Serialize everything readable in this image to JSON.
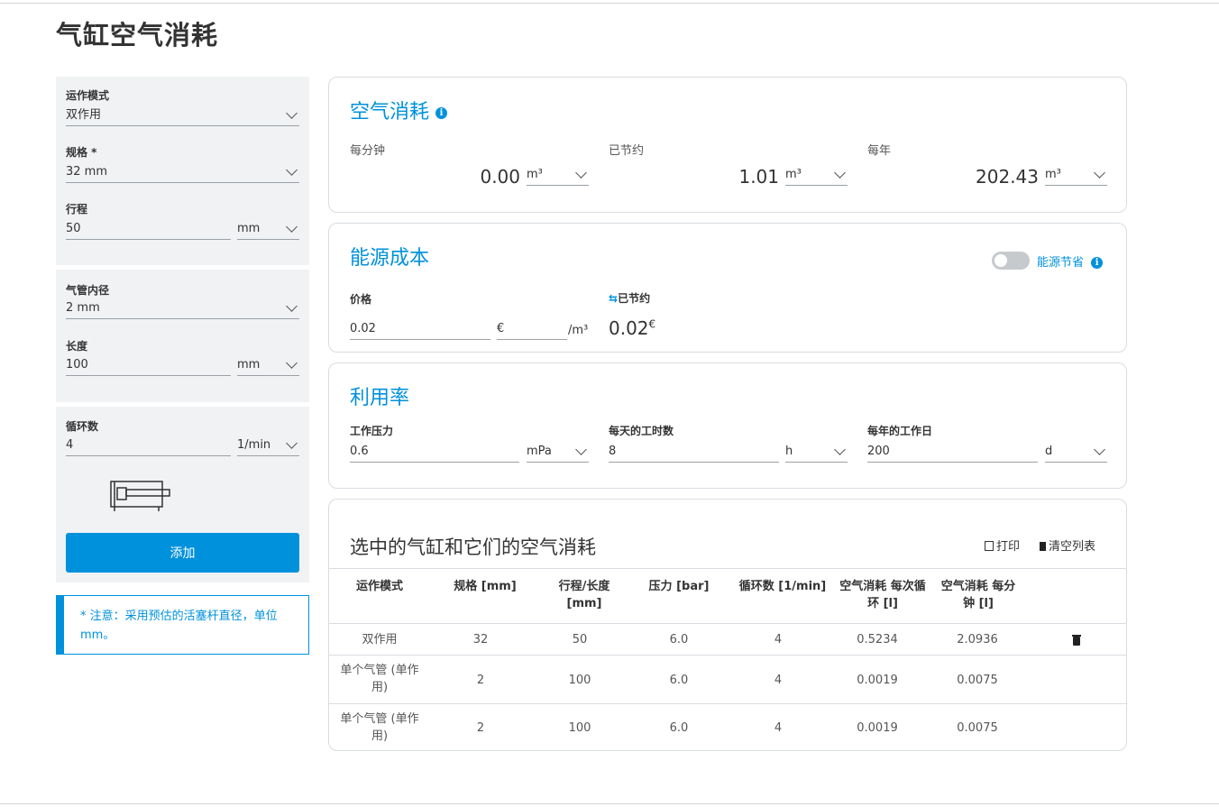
{
  "page": {
    "title": "气缸空气消耗"
  },
  "left": {
    "mode_label": "运作模式",
    "mode_value": "双作用",
    "size_label": "规格 *",
    "size_value": "32 mm",
    "stroke_label": "行程",
    "stroke_value": "50",
    "stroke_unit": "mm",
    "tube_label": "气管内径",
    "tube_value": "2 mm",
    "length_label": "长度",
    "length_value": "100",
    "length_unit": "mm",
    "cycles_label": "循环数",
    "cycles_value": "4",
    "cycles_unit": "1/min",
    "add_button": "添加",
    "note": "* 注意：采用预估的活塞杆直径，单位 mm。"
  },
  "consumption": {
    "title": "空气消耗",
    "per_minute_label": "每分钟",
    "per_minute_value": "0.00",
    "per_minute_unit": "m³",
    "saved_label": "已节约",
    "saved_value": "1.01",
    "saved_unit": "m³",
    "per_year_label": "每年",
    "per_year_value": "202.43",
    "per_year_unit": "m³"
  },
  "energy": {
    "title": "能源成本",
    "toggle_label": "能源节省",
    "price_label": "价格",
    "price_value": "0.02",
    "currency": "€",
    "per_unit": "/m³",
    "saved_label": "已节约",
    "saved_value": "0.02",
    "saved_currency": "€"
  },
  "utilization": {
    "title": "利用率",
    "pressure_label": "工作压力",
    "pressure_value": "0.6",
    "pressure_unit": "mPa",
    "hours_label": "每天的工时数",
    "hours_value": "8",
    "hours_unit": "h",
    "days_label": "每年的工作日",
    "days_value": "200",
    "days_unit": "d"
  },
  "table": {
    "title": "选中的气缸和它们的空气消耗",
    "print_label": "打印",
    "clear_label": "清空列表",
    "headers": [
      "运作模式",
      "规格 [mm]",
      "行程/长度 [mm]",
      "压力 [bar]",
      "循环数 [1/min]",
      "空气消耗 每次循环 [l]",
      "空气消耗 每分钟 [l]"
    ],
    "rows": [
      [
        "双作用",
        "32",
        "50",
        "6.0",
        "4",
        "0.5234",
        "2.0936"
      ],
      [
        "单个气管 (单作用)",
        "2",
        "100",
        "6.0",
        "4",
        "0.0019",
        "0.0075"
      ],
      [
        "单个气管 (单作用)",
        "2",
        "100",
        "6.0",
        "4",
        "0.0019",
        "0.0075"
      ]
    ]
  },
  "colors": {
    "accent": "#0091dc",
    "panel_bg": "#f0f2f4"
  }
}
